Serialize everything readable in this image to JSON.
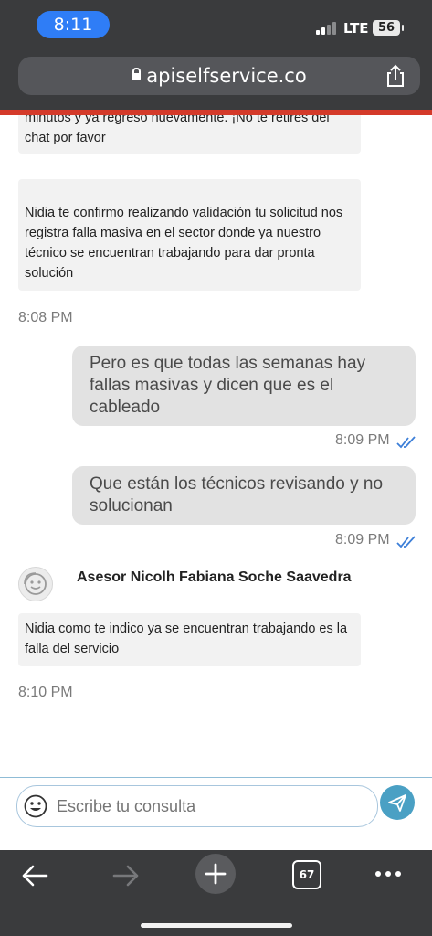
{
  "status_bar": {
    "time": "8:11",
    "network": "LTE",
    "battery": "56"
  },
  "browser": {
    "url": "apiselfservice.co",
    "tab_count": "67"
  },
  "chat": {
    "partial_message_line1": "minutos y ya regreso nuevamente. ¡No te retires del",
    "partial_message_line2": "chat por favor",
    "messages": [
      {
        "text": "Nidia te confirmo realizando validación tu solicitud nos registra falla masiva en el sector donde ya nuestro técnico se encuentran trabajando para dar pronta solución"
      },
      {
        "time": "8:08 PM"
      },
      {
        "text": "Pero es que todas las semanas hay fallas masivas y dicen que es el cableado",
        "time": "8:09 PM"
      },
      {
        "text": "Que están los técnicos revisando y no solucionan",
        "time": "8:09 PM"
      },
      {
        "text": "Nidia como te indico ya se encuentran trabajando es la falla del servicio",
        "time": "8:10 PM"
      }
    ],
    "agent_name": "Asesor Nicolh Fabiana Soche Saavedra"
  },
  "input": {
    "placeholder": "Escribe tu consulta"
  },
  "colors": {
    "accent_blue": "#2f7df6",
    "send_button": "#4aa0c4",
    "chrome": "#3a3b3d",
    "read_check": "#3d7fd8",
    "header_red": "#d43a2a"
  },
  "icons": [
    "lock-icon",
    "share-icon",
    "checkmark-double-icon",
    "agent-avatar-icon",
    "emoji-icon",
    "send-icon",
    "back-arrow-icon",
    "forward-arrow-icon",
    "plus-icon",
    "tabs-icon",
    "more-icon"
  ]
}
